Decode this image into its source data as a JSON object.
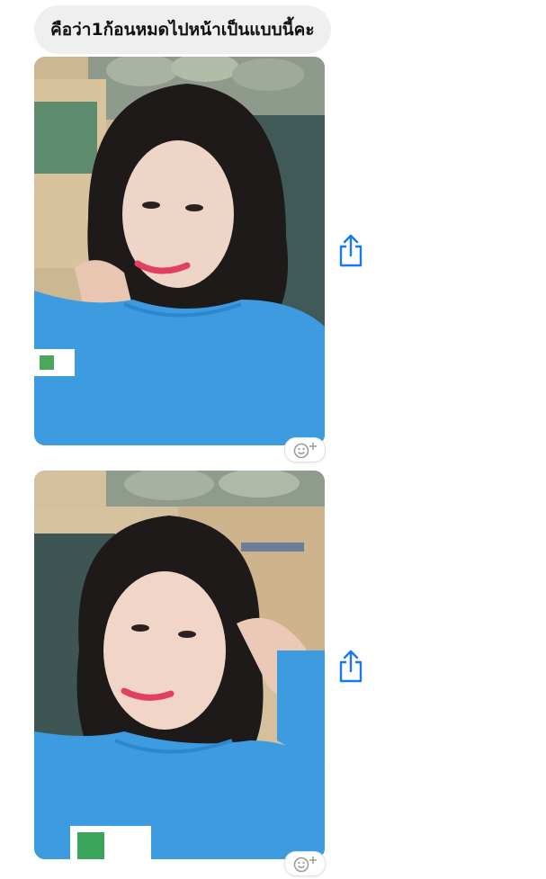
{
  "messages": [
    {
      "type": "text",
      "text": "คือว่า1ก้อนหมดไปหน้าเป็นแบบนี้คะ"
    },
    {
      "type": "photo",
      "description_icon": "selfie-photo"
    },
    {
      "type": "photo",
      "description_icon": "selfie-photo"
    }
  ],
  "icons": {
    "share": "share-icon",
    "reaction": "add-reaction-icon"
  },
  "colors": {
    "bubble_bg": "#efefef",
    "accent_blue": "#1877f2",
    "shirt_blue": "#3d9be0"
  }
}
